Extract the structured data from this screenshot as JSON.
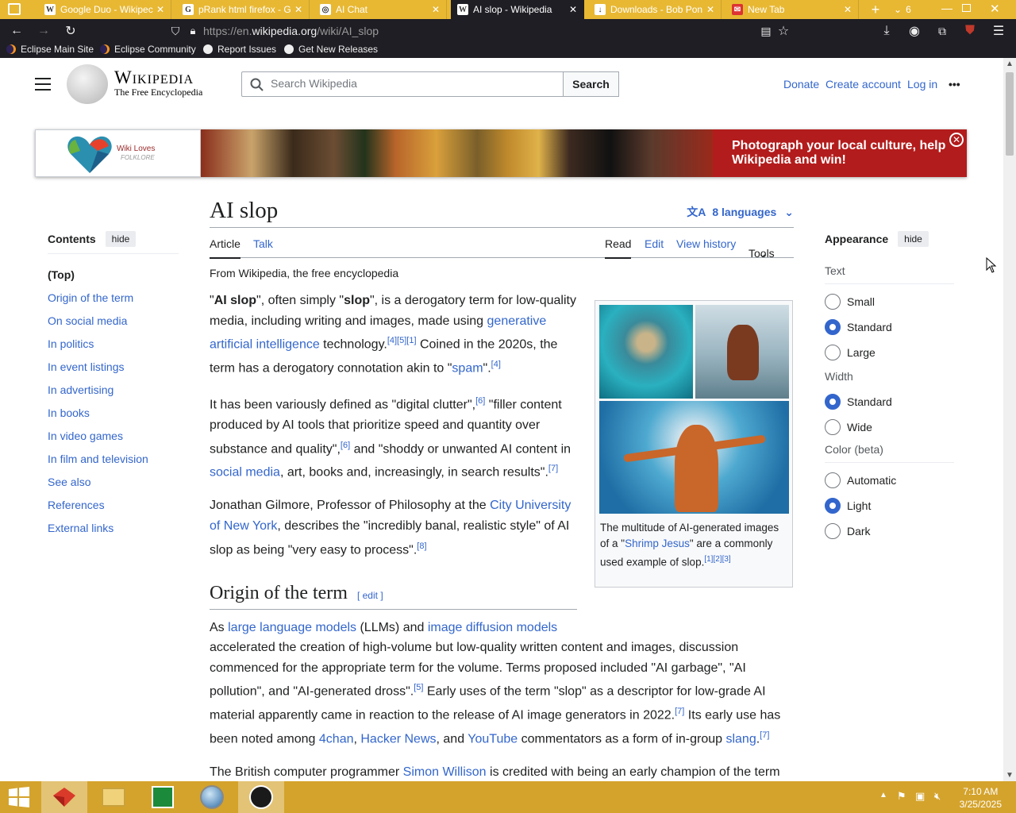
{
  "browser": {
    "tabs": [
      {
        "icon": "W",
        "title": "Google Duo - Wikipec"
      },
      {
        "icon": "G",
        "title": "pRank html firefox - G"
      },
      {
        "icon": "◎",
        "title": "AI Chat"
      },
      {
        "icon": "W",
        "title": "AI slop - Wikipedia"
      },
      {
        "icon": "↓",
        "title": "Downloads - Bob Pon"
      },
      {
        "icon": "✉",
        "title": "New Tab"
      }
    ],
    "tab_count": "6",
    "url_prefix": "https://en.",
    "url_domain": "wikipedia.org",
    "url_path": "/wiki/AI_slop",
    "bookmarks": [
      "Eclipse Main Site",
      "Eclipse Community",
      "Report Issues",
      "Get New Releases"
    ]
  },
  "header": {
    "wordmark": "Wikipedia",
    "tagline": "The Free Encyclopedia",
    "search_placeholder": "Search Wikipedia",
    "search_button": "Search",
    "links": [
      "Donate",
      "Create account",
      "Log in"
    ],
    "more": "•••"
  },
  "banner": {
    "logo_text_1": "Wiki Loves",
    "logo_text_2": "FOLKLORE",
    "message": "Photograph your local culture, help Wikipedia and win!",
    "close": "✕"
  },
  "toc": {
    "title": "Contents",
    "hide": "hide",
    "items": [
      "(Top)",
      "Origin of the term",
      "On social media",
      "In politics",
      "In event listings",
      "In advertising",
      "In books",
      "In video games",
      "In film and television",
      "See also",
      "References",
      "External links"
    ]
  },
  "article": {
    "title": "AI slop",
    "languages": "8 languages",
    "tab_article": "Article",
    "tab_talk": "Talk",
    "tab_read": "Read",
    "tab_edit": "Edit",
    "tab_history": "View history",
    "tab_tools": "Tools",
    "from": "From Wikipedia, the free encyclopedia",
    "caption_1": "The multitude of AI-generated images of a \"",
    "caption_link": "Shrimp Jesus",
    "caption_2": "\" are a commonly used example of slop.",
    "caption_refs": "[1][2][3]",
    "section1": "Origin of the term",
    "edit": "edit"
  },
  "appearance": {
    "title": "Appearance",
    "hide": "hide",
    "text_label": "Text",
    "text_options": [
      "Small",
      "Standard",
      "Large"
    ],
    "width_label": "Width",
    "width_options": [
      "Standard",
      "Wide"
    ],
    "color_label": "Color (beta)",
    "color_options": [
      "Automatic",
      "Light",
      "Dark"
    ]
  },
  "taskbar": {
    "time": "7:10 AM",
    "date": "3/25/2025"
  }
}
